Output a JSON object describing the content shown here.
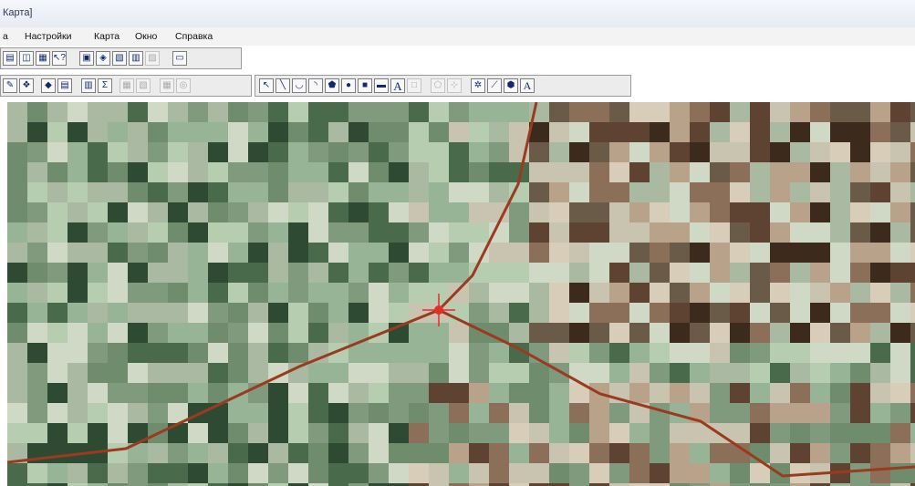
{
  "window": {
    "title": "Карта]"
  },
  "menu": [
    {
      "id": "m0",
      "label": "а"
    },
    {
      "id": "m1",
      "label": "Настройки"
    },
    {
      "id": "m2",
      "label": "Карта"
    },
    {
      "id": "m3",
      "label": "Окно"
    },
    {
      "id": "m4",
      "label": "Справка"
    }
  ],
  "toolbar": {
    "sigma_glyph": "Σ",
    "text_glyph": "A",
    "text_tool2_glyph": "A"
  },
  "map": {
    "line_color": "#9b3a1f",
    "cursor_color": "#e0302a",
    "palette": [
      "#2f4a33",
      "#4a6a4c",
      "#6f8d6c",
      "#98b496",
      "#b6cdb0",
      "#cfd9c5",
      "#d8cdb8",
      "#b8a38a",
      "#8b6f58",
      "#5e4332",
      "#3c2a1d",
      "#a9b9a2",
      "#7f9a7d",
      "#c9c4b0",
      "#6a5a48"
    ]
  }
}
